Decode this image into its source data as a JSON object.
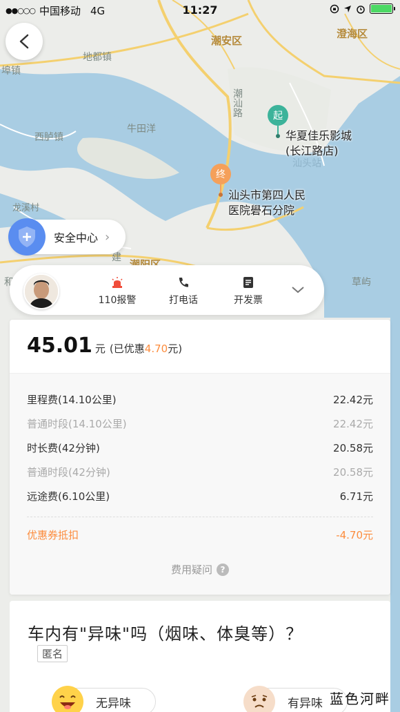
{
  "status_bar": {
    "carrier": "中国移动",
    "network": "4G",
    "time": "11:27"
  },
  "map": {
    "labels": [
      "潮安区",
      "澄海区",
      "地都镇",
      "埠镇",
      "西胪镇",
      "牛田洋",
      "潮汕路",
      "汕头站",
      "龙溪村",
      "潮阳区",
      "草屿",
      "和",
      "建"
    ],
    "start_pin": {
      "text": "起",
      "label_line1": "华夏佳乐影城",
      "label_line2": "(长江路店)",
      "color": "#3cb39a"
    },
    "end_pin": {
      "text": "终",
      "label_line1": "汕头市第四人民",
      "label_line2": "医院礐石分院",
      "color": "#f5a05a"
    }
  },
  "safety_center": {
    "label": "安全中心"
  },
  "driver_actions": [
    {
      "label": "110报警",
      "icon": "alarm-icon"
    },
    {
      "label": "打电话",
      "icon": "phone-icon"
    },
    {
      "label": "开发票",
      "icon": "invoice-icon"
    }
  ],
  "fee": {
    "total": "45.01",
    "unit": "元",
    "discount_prefix": "(已优惠",
    "discount_amount": "4.70",
    "discount_suffix": "元)",
    "items": [
      {
        "name": "里程费(14.10公里)",
        "amount": "22.42元",
        "sub": false
      },
      {
        "name": "普通时段(14.10公里)",
        "amount": "22.42元",
        "sub": true
      },
      {
        "name": "时长费(42分钟)",
        "amount": "20.58元",
        "sub": false
      },
      {
        "name": "普通时段(42分钟)",
        "amount": "20.58元",
        "sub": true
      },
      {
        "name": "远途费(6.10公里)",
        "amount": "6.71元",
        "sub": false
      }
    ],
    "coupon": {
      "name": "优惠券抵扣",
      "amount": "-4.70元"
    },
    "question": "费用疑问",
    "accent_color": "#fc8c3d"
  },
  "survey": {
    "question": "车内有\"异味\"吗（烟味、体臭等）？",
    "anonymous": "匿名",
    "option_no": "无异味",
    "option_yes": "有异味"
  },
  "watermark": "蓝色河畔"
}
